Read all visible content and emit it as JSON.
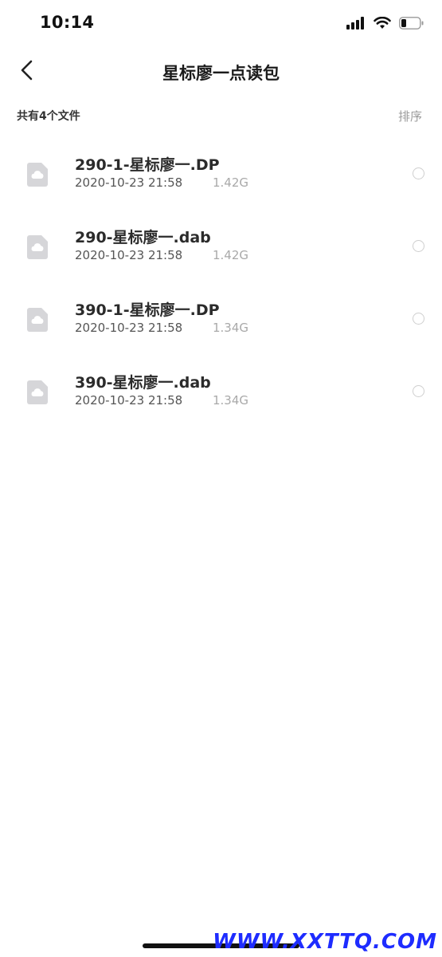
{
  "status_bar": {
    "time": "10:14",
    "icons": [
      "signal-icon",
      "wifi-icon",
      "battery-icon"
    ]
  },
  "nav": {
    "title": "星标廖一点读包",
    "back_icon": "chevron-left-icon"
  },
  "list_header": {
    "count_text": "共有4个文件",
    "sort_label": "排序"
  },
  "files": [
    {
      "name": "290-1-星标廖一.DP",
      "date": "2020-10-23 21:58",
      "size": "1.42G"
    },
    {
      "name": "290-星标廖一.dab",
      "date": "2020-10-23 21:58",
      "size": "1.42G"
    },
    {
      "name": "390-1-星标廖一.DP",
      "date": "2020-10-23 21:58",
      "size": "1.34G"
    },
    {
      "name": "390-星标廖一.dab",
      "date": "2020-10-23 21:58",
      "size": "1.34G"
    }
  ],
  "watermark": "WWW.XXTTQ.COM",
  "colors": {
    "text_primary": "#2b2b2b",
    "text_secondary": "#555555",
    "text_muted": "#a9a9a9",
    "icon_gray": "#d6d6d9",
    "watermark": "#1e2cff"
  }
}
